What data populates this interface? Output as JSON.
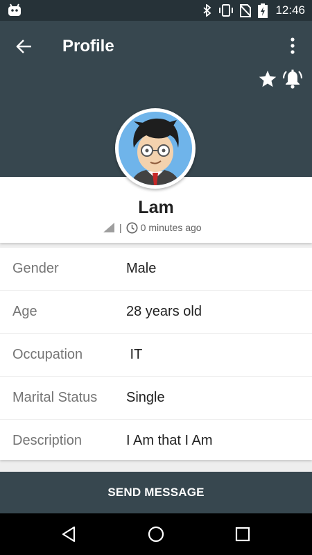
{
  "status_bar": {
    "time": "12:46",
    "icons": [
      "android-icon",
      "bluetooth-icon",
      "vibrate-icon",
      "no-sim-icon",
      "battery-charging-icon"
    ]
  },
  "toolbar": {
    "title": "Profile",
    "back_icon": "arrow-back-icon",
    "more_icon": "more-vert-icon",
    "favorite_icon": "star-icon",
    "notify_icon": "bell-ring-icon"
  },
  "profile": {
    "name": "Lam",
    "signal_icon": "signal-icon",
    "separator": "|",
    "clock_icon": "clock-icon",
    "last_seen": "0 minutes ago"
  },
  "details": [
    {
      "label": "Gender",
      "value": "Male"
    },
    {
      "label": "Age",
      "value": "28 years old"
    },
    {
      "label": "Occupation",
      "value": " IT"
    },
    {
      "label": "Marital Status",
      "value": "Single"
    },
    {
      "label": "Description",
      "value": "I Am that I Am"
    }
  ],
  "actions": {
    "send_message": "SEND MESSAGE"
  },
  "nav_bar": {
    "icons": [
      "back-triangle-icon",
      "home-circle-icon",
      "recents-square-icon"
    ]
  },
  "colors": {
    "header": "#37474f",
    "status_bar": "#263238",
    "send_button": "#37474f"
  }
}
